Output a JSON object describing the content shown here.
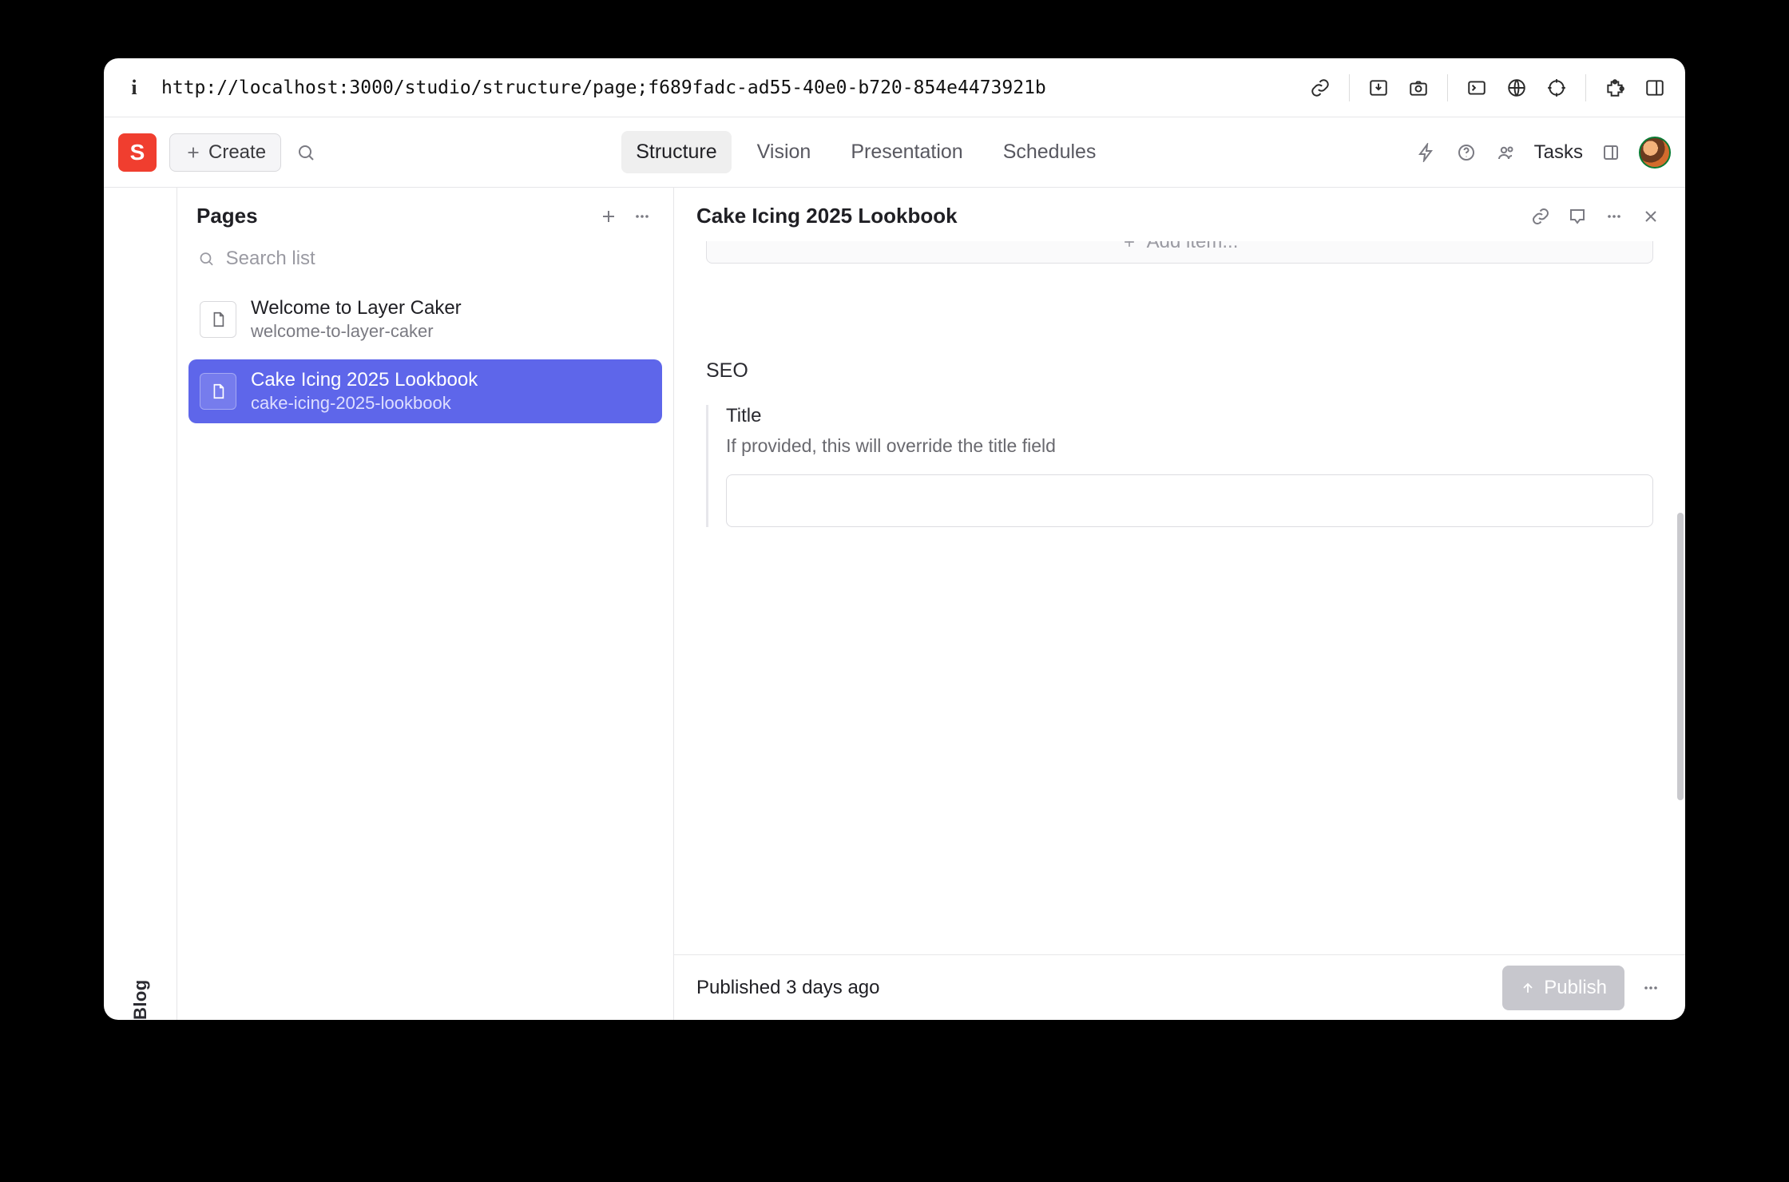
{
  "addr": {
    "url": "http://localhost:3000/studio/structure/page;f689fadc-ad55-40e0-b720-854e4473921b"
  },
  "logo_letter": "S",
  "create_label": "Create",
  "nav": {
    "tabs": [
      "Structure",
      "Vision",
      "Presentation",
      "Schedules"
    ],
    "active": 0
  },
  "tasks_label": "Tasks",
  "rail": {
    "label": "Blog"
  },
  "list": {
    "title": "Pages",
    "search_placeholder": "Search list",
    "items": [
      {
        "title": "Welcome to Layer Caker",
        "slug": "welcome-to-layer-caker",
        "selected": false
      },
      {
        "title": "Cake Icing 2025 Lookbook",
        "slug": "cake-icing-2025-lookbook",
        "selected": true
      }
    ]
  },
  "doc": {
    "title": "Cake Icing 2025 Lookbook",
    "add_item_label": "Add item...",
    "seo_label": "SEO",
    "seo_title_label": "Title",
    "seo_title_help": "If provided, this will override the title field",
    "seo_title_value": "",
    "status_text": "Published 3 days ago",
    "publish_label": "Publish"
  }
}
